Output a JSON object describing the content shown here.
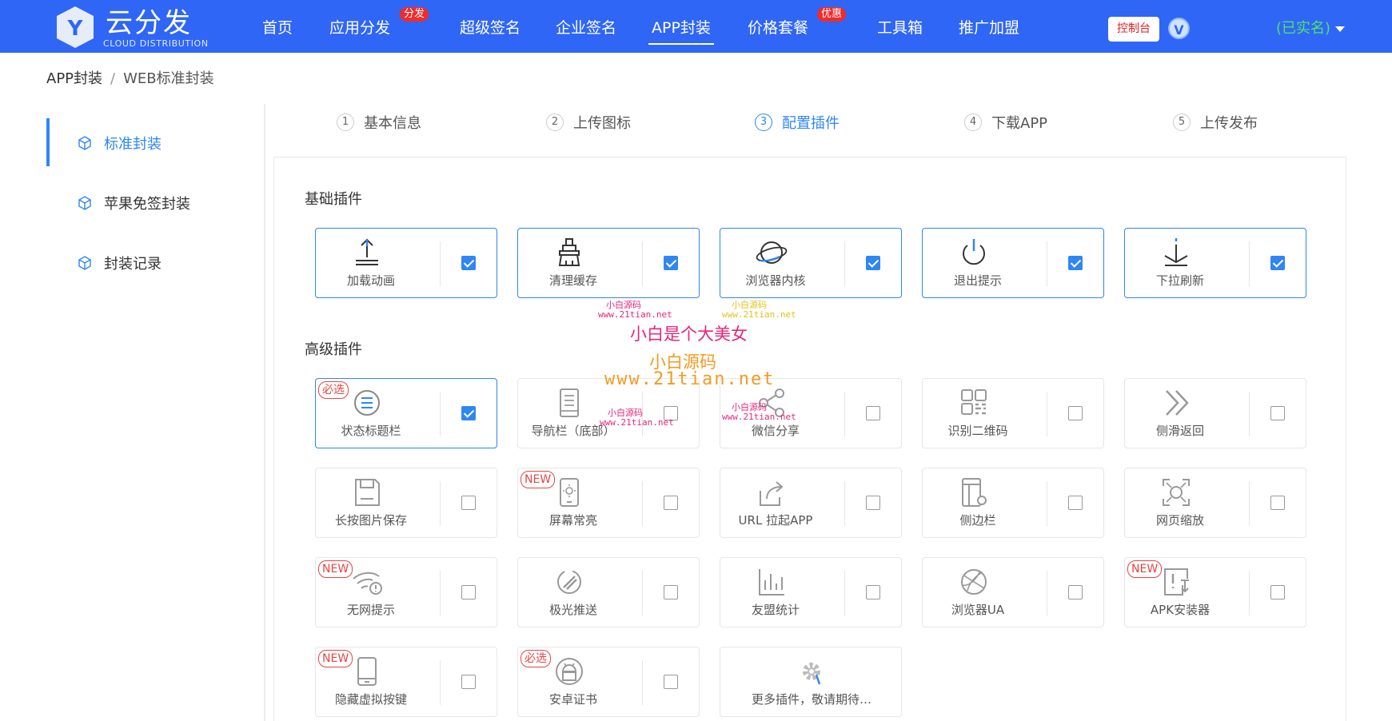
{
  "header": {
    "logo_text": "云分发",
    "logo_sub": "CLOUD DISTRIBUTION",
    "logo_letter": "Y",
    "nav": [
      {
        "label": "首页",
        "badge": ""
      },
      {
        "label": "应用分发",
        "badge": "分发"
      },
      {
        "label": "超级签名",
        "badge": ""
      },
      {
        "label": "企业签名",
        "badge": ""
      },
      {
        "label": "APP封装",
        "badge": "",
        "active": true
      },
      {
        "label": "价格套餐",
        "badge": "优惠"
      },
      {
        "label": "工具箱",
        "badge": ""
      },
      {
        "label": "推广加盟",
        "badge": ""
      }
    ],
    "console_label": "控制台",
    "vip_letter": "V",
    "verified_label": "(已实名)"
  },
  "breadcrumb": {
    "root": "APP封装",
    "sep": "/",
    "current": "WEB标准封装"
  },
  "sidebar": {
    "items": [
      {
        "label": "标准封装",
        "active": true
      },
      {
        "label": "苹果免签封装",
        "active": false
      },
      {
        "label": "封装记录",
        "active": false
      }
    ]
  },
  "steps": [
    {
      "num": "1",
      "label": "基本信息"
    },
    {
      "num": "2",
      "label": "上传图标"
    },
    {
      "num": "3",
      "label": "配置插件",
      "active": true
    },
    {
      "num": "4",
      "label": "下载APP"
    },
    {
      "num": "5",
      "label": "上传发布"
    }
  ],
  "sections": {
    "basic": "基础插件",
    "advanced": "高级插件"
  },
  "basic_plugins": [
    {
      "label": "加载动画",
      "icon": "upload-icon",
      "checked": true
    },
    {
      "label": "清理缓存",
      "icon": "broom-icon",
      "checked": true
    },
    {
      "label": "浏览器内核",
      "icon": "planet-icon",
      "checked": true
    },
    {
      "label": "退出提示",
      "icon": "power-icon",
      "checked": true
    },
    {
      "label": "下拉刷新",
      "icon": "pull-down-icon",
      "checked": true
    }
  ],
  "advanced_plugins": [
    {
      "label": "状态标题栏",
      "icon": "status-bar-icon",
      "checked": true,
      "tag": "必选"
    },
    {
      "label": "导航栏（底部）",
      "icon": "bottom-nav-icon",
      "checked": false,
      "tag": ""
    },
    {
      "label": "微信分享",
      "icon": "share-icon",
      "checked": false,
      "tag": ""
    },
    {
      "label": "识别二维码",
      "icon": "qr-code-icon",
      "checked": false,
      "tag": ""
    },
    {
      "label": "侧滑返回",
      "icon": "double-chevron-icon",
      "checked": false,
      "tag": ""
    },
    {
      "label": "长按图片保存",
      "icon": "save-icon",
      "checked": false,
      "tag": ""
    },
    {
      "label": "屏幕常亮",
      "icon": "phone-brightness-icon",
      "checked": false,
      "tag": "NEW"
    },
    {
      "label": "URL 拉起APP",
      "icon": "launch-icon",
      "checked": false,
      "tag": ""
    },
    {
      "label": "侧边栏",
      "icon": "sidebar-icon",
      "checked": false,
      "tag": ""
    },
    {
      "label": "网页缩放",
      "icon": "zoom-icon",
      "checked": false,
      "tag": ""
    },
    {
      "label": "无网提示",
      "icon": "wifi-off-icon",
      "checked": false,
      "tag": "NEW"
    },
    {
      "label": "极光推送",
      "icon": "push-icon",
      "checked": false,
      "tag": ""
    },
    {
      "label": "友盟统计",
      "icon": "bar-stats-icon",
      "checked": false,
      "tag": ""
    },
    {
      "label": "浏览器UA",
      "icon": "globe-icon",
      "checked": false,
      "tag": ""
    },
    {
      "label": "APK安装器",
      "icon": "apk-install-icon",
      "checked": false,
      "tag": "NEW"
    },
    {
      "label": "隐藏虚拟按键",
      "icon": "phone-icon",
      "checked": false,
      "tag": "NEW"
    },
    {
      "label": "安卓证书",
      "icon": "android-icon",
      "checked": false,
      "tag": "必选"
    }
  ],
  "more_plugins": {
    "label": "更多插件，敬请期待…",
    "icon": "gear-icon"
  },
  "watermark": {
    "brand": "小白源码",
    "url": "www.21tian.net",
    "slogan": "小白是个大美女"
  }
}
